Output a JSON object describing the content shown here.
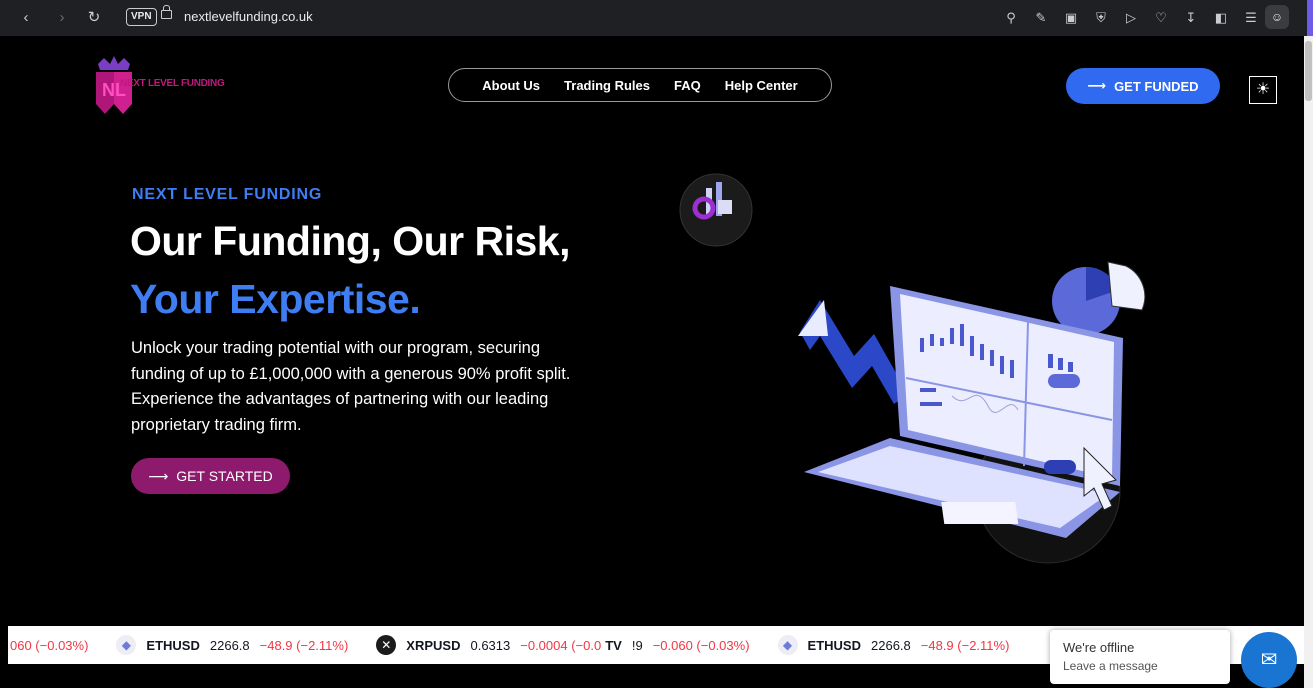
{
  "browser": {
    "url": "nextlevelfunding.co.uk",
    "vpn_label": "VPN"
  },
  "logo": {
    "text": "NEXT LEVEL FUNDING",
    "mark": "NL"
  },
  "nav": {
    "items": [
      "About Us",
      "Trading Rules",
      "FAQ",
      "Help Center"
    ]
  },
  "header": {
    "cta_label": "GET FUNDED"
  },
  "hero": {
    "eyebrow": "NEXT LEVEL FUNDING",
    "title_line1": "Our Funding, Our Risk,",
    "title_line2": "Your Expertise.",
    "description": "Unlock your trading potential with our program, securing funding of up to £1,000,000 with a generous 90% profit split. Experience the advantages of partnering with our leading proprietary trading firm.",
    "cta_label": "GET STARTED"
  },
  "ticker": [
    {
      "symbol": "",
      "price": "",
      "change": "060 (−0.03%)",
      "icon": "none"
    },
    {
      "symbol": "ETHUSD",
      "price": "2266.8",
      "change": "−48.9 (−2.11%)",
      "icon": "ethereum-icon"
    },
    {
      "symbol": "XRPUSD",
      "price": "0.6313",
      "change": "−0.0004 (−0.0",
      "icon": "xrp-icon"
    },
    {
      "symbol": "",
      "price": "!9",
      "change": "−0.060 (−0.03%)",
      "icon": "tradingview-icon"
    },
    {
      "symbol": "ETHUSD",
      "price": "2266.8",
      "change": "−48.9 (−2.11%)",
      "icon": "ethereum-icon"
    }
  ],
  "chat": {
    "status": "We're offline",
    "action": "Leave a message"
  },
  "colors": {
    "accent_blue": "#2f6af0",
    "brand_magenta": "#8e1a6d",
    "negative": "#f23645"
  }
}
